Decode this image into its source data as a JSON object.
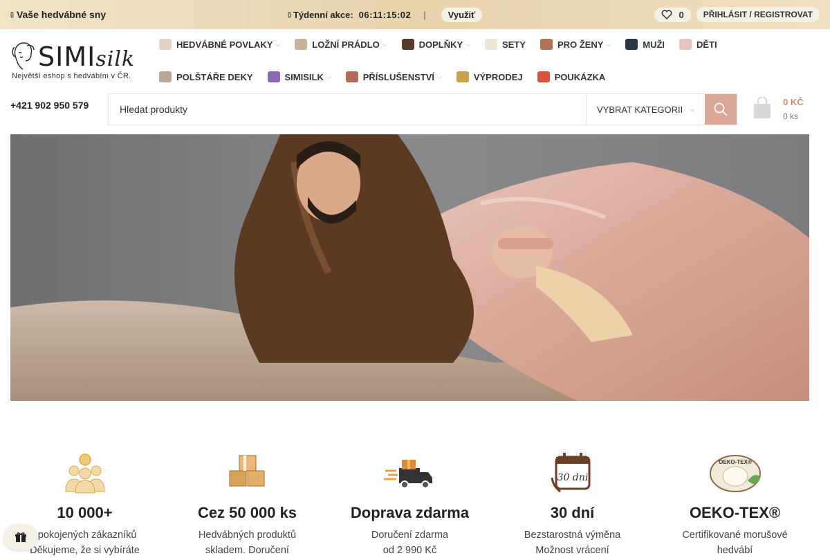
{
  "topbar": {
    "left_text": "Vaše hedvábné sny",
    "deal_label": "Týdenní akce:",
    "timer": "06:11:15:02",
    "separator": "|",
    "use_button": "Využiť",
    "wishlist_count": "0",
    "login_label": "PŘIHLÁSIT / REGISTROVAT"
  },
  "logo": {
    "name": "SIMI",
    "name_suffix": "silk",
    "tagline": "Největší eshop s hedvábím v ČR."
  },
  "nav": {
    "row1": [
      {
        "label": "HEDVÁBNÉ POVLAKY",
        "icon": "pillowcase-icon",
        "dropdown": true
      },
      {
        "label": "LOŽNÍ PRÁDLO",
        "icon": "bed-icon",
        "dropdown": true
      },
      {
        "label": "DOPLŇKY",
        "icon": "scrunchie-icon",
        "dropdown": true
      },
      {
        "label": "SETY",
        "icon": "set-icon",
        "dropdown": false
      },
      {
        "label": "PRO ŽENY",
        "icon": "woman-icon",
        "dropdown": true
      },
      {
        "label": "MUŽI",
        "icon": "man-icon",
        "dropdown": false
      },
      {
        "label": "DĚTI",
        "icon": "kids-icon",
        "dropdown": false
      }
    ],
    "row2": [
      {
        "label": "POLŠTÁŘE DEKY",
        "icon": "pillow-icon",
        "dropdown": false
      },
      {
        "label": "SIMISILK",
        "icon": "fabric-icon",
        "dropdown": true
      },
      {
        "label": "PŘÍSLUŠENSTVÍ",
        "icon": "accessory-icon",
        "dropdown": true
      },
      {
        "label": "VÝPRODEJ",
        "icon": "tag-icon",
        "dropdown": false
      },
      {
        "label": "POUKÁZKA",
        "icon": "gift-icon",
        "dropdown": false
      }
    ]
  },
  "contact": {
    "phone": "+421 902 950 579"
  },
  "search": {
    "placeholder": "Hledat produkty",
    "category_label": "VYBRAT KATEGORII"
  },
  "cart": {
    "price": "0 KČ",
    "count": "0 ks"
  },
  "colors": {
    "accent": "#d9a896",
    "price": "#c98a72",
    "topbar": "#ecd8b4"
  },
  "features": [
    {
      "icon": "customers-icon",
      "title": "10 000+",
      "line1": "spokojených zákazníků",
      "line2": "Děkujeme, že si vybíráte"
    },
    {
      "icon": "boxes-icon",
      "title": "Cez 50 000 ks",
      "line1": "Hedvábných produktů",
      "line2": "skladem. Doručení"
    },
    {
      "icon": "delivery-truck-icon",
      "title": "Doprava zdarma",
      "line1": "Doručení zdarma",
      "line2": "od 2 990 Kč"
    },
    {
      "icon": "calendar-30-icon",
      "title": "30 dní",
      "line1": "Bezstarostná výměna",
      "line2": "Možnost vrácení"
    },
    {
      "icon": "oeko-tex-icon",
      "title": "OEKO-TEX®",
      "line1": "Certifikované morušové",
      "line2": "hedvábí"
    }
  ]
}
